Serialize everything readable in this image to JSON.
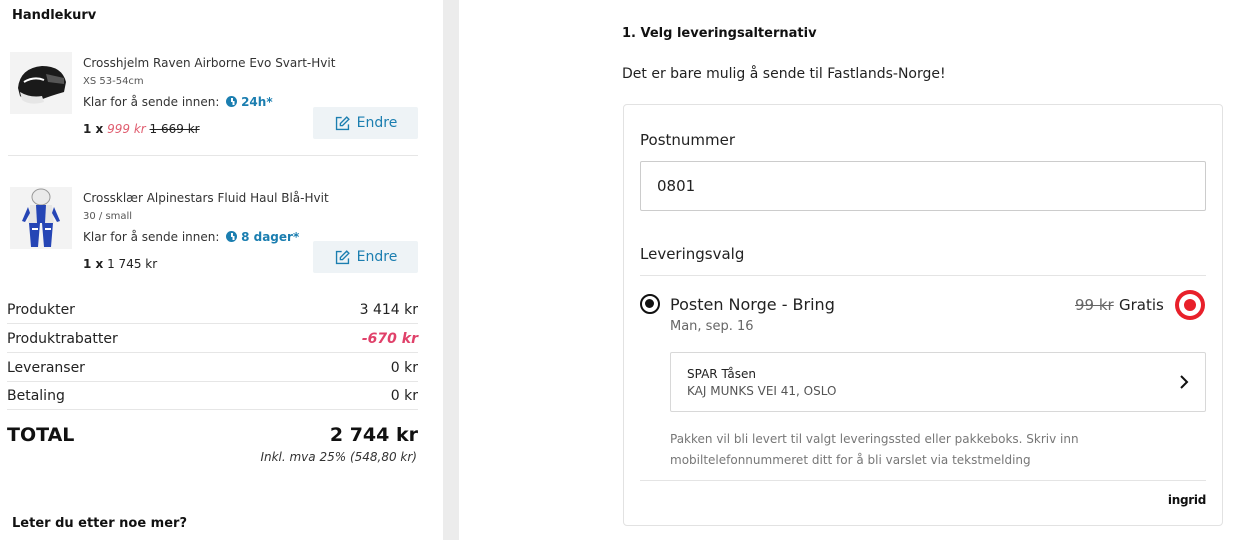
{
  "cart": {
    "title": "Handlekurv",
    "items": [
      {
        "name": "Crosshjelm Raven Airborne Evo Svart-Hvit",
        "size": "XS 53-54cm",
        "ship_label": "Klar for å sende innen:",
        "ship_time": "24h*",
        "qty": "1 x",
        "price_sale": "999 kr",
        "price_orig": "1 669 kr",
        "edit_label": "Endre"
      },
      {
        "name": "Crossklær Alpinestars Fluid Haul Blå-Hvit",
        "size": "30 / small",
        "ship_label": "Klar for å sende innen:",
        "ship_time": "8 dager*",
        "qty": "1 x",
        "price": "1 745 kr",
        "edit_label": "Endre"
      }
    ],
    "summary": [
      {
        "label": "Produkter",
        "value": "3 414 kr"
      },
      {
        "label": "Produktrabatter",
        "value": "-670 kr"
      },
      {
        "label": "Leveranser",
        "value": "0 kr"
      },
      {
        "label": "Betaling",
        "value": "0 kr"
      }
    ],
    "total_label": "TOTAL",
    "total_value": "2 744 kr",
    "vat_note": "Inkl. mva 25% (548,80 kr)",
    "more_heading": "Leter du etter noe mer?"
  },
  "delivery": {
    "step_title": "1. Velg leveringsalternativ",
    "notice": "Det er bare mulig å sende til Fastlands-Norge!",
    "postal_label": "Postnummer",
    "postal_value": "0801",
    "options_label": "Leveringsvalg",
    "option": {
      "carrier": "Posten Norge - Bring",
      "date": "Man, sep. 16",
      "old_price": "99 kr",
      "price": "Gratis",
      "pickup_name": "SPAR Tåsen",
      "pickup_address": "KAJ MUNKS VEI 41, OSLO"
    },
    "info_text": "Pakken vil bli levert til valgt leveringssted eller pakkeboks. Skriv inn mobiltelefonnummeret ditt for å bli varslet via tekstmelding",
    "provider": "ingrid"
  },
  "colors": {
    "accent_blue": "#1b7eb0",
    "sale_pink": "#e05d6f",
    "discount_red": "#e0416a",
    "bring_red": "#e8202a"
  }
}
